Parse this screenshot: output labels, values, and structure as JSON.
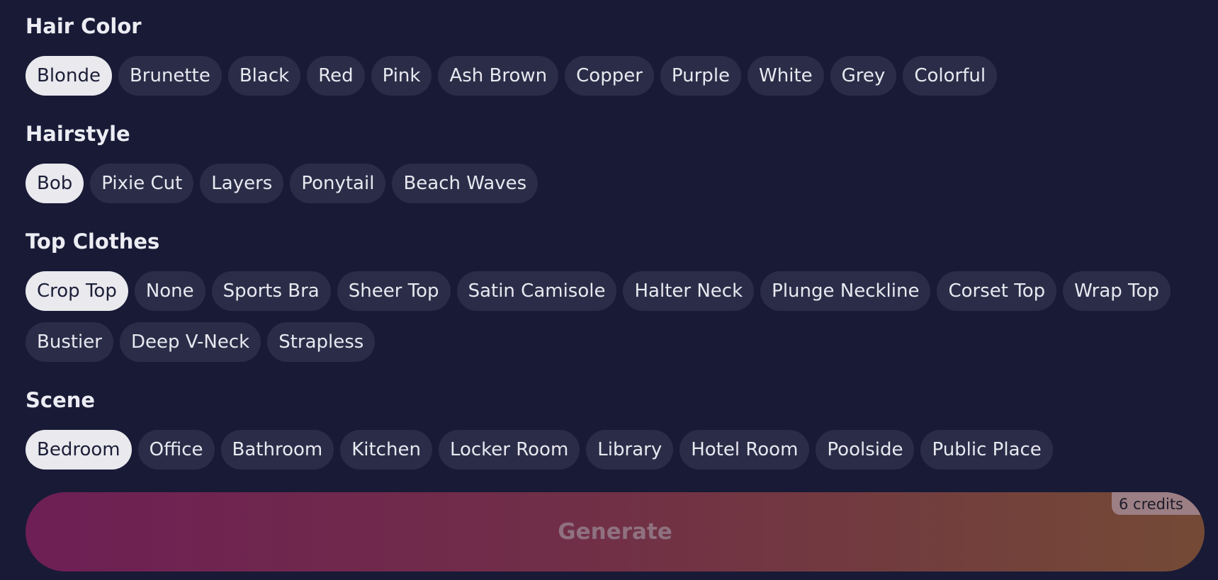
{
  "sections": [
    {
      "title": "Hair Color",
      "options": [
        "Blonde",
        "Brunette",
        "Black",
        "Red",
        "Pink",
        "Ash Brown",
        "Copper",
        "Purple",
        "White",
        "Grey",
        "Colorful"
      ],
      "selected": "Blonde"
    },
    {
      "title": "Hairstyle",
      "options": [
        "Bob",
        "Pixie Cut",
        "Layers",
        "Ponytail",
        "Beach Waves"
      ],
      "selected": "Bob"
    },
    {
      "title": "Top Clothes",
      "options": [
        "Crop Top",
        "None",
        "Sports Bra",
        "Sheer Top",
        "Satin Camisole",
        "Halter Neck",
        "Plunge Neckline",
        "Corset Top",
        "Wrap Top",
        "Bustier",
        "Deep V-Neck",
        "Strapless"
      ],
      "selected": "Crop Top"
    },
    {
      "title": "Scene",
      "options": [
        "Bedroom",
        "Office",
        "Bathroom",
        "Kitchen",
        "Locker Room",
        "Library",
        "Hotel Room",
        "Poolside",
        "Public Place"
      ],
      "selected": "Bedroom"
    }
  ],
  "generate": {
    "label": "Generate",
    "credits": "6 credits"
  },
  "colors": {
    "background": "#181a36",
    "chip": "#2b2d48",
    "chip_selected": "#e9e9ee",
    "gradient_start": "#6e1f55",
    "gradient_end": "#744a36"
  }
}
